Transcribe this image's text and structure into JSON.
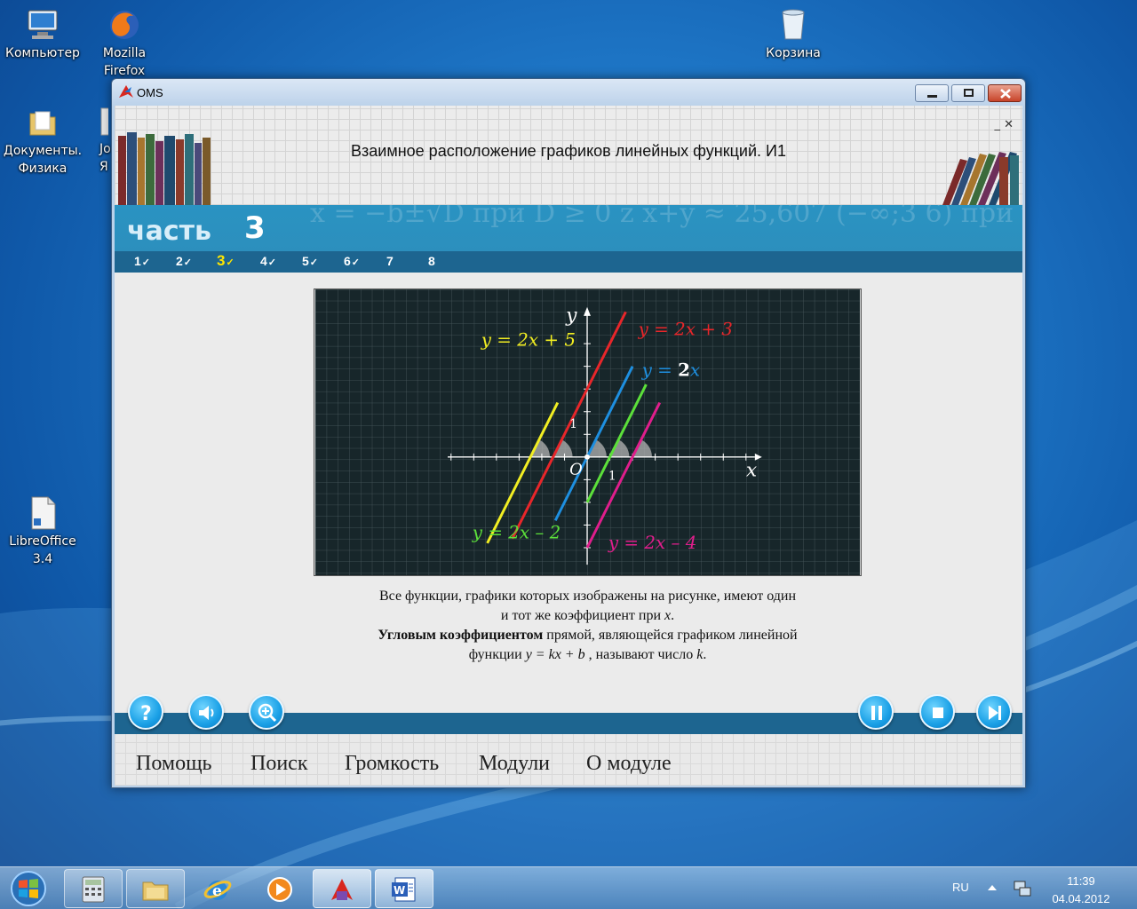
{
  "desktop": {
    "icons": [
      {
        "label": "Компьютер",
        "icon": "computer-icon"
      },
      {
        "label": "Mozilla Firefox",
        "icon": "firefox-icon"
      },
      {
        "label": "Корзина",
        "icon": "recycle-bin-icon"
      },
      {
        "label": "Документы. Физика",
        "icon": "folder-icon"
      },
      {
        "label": "Jo Я",
        "icon": "shortcut-icon"
      },
      {
        "label": "LibreOffice 3.4",
        "icon": "libreoffice-icon"
      }
    ]
  },
  "window": {
    "title": "OMS",
    "lesson_title": "Взаимное расположение графиков линейных функций. И1",
    "mini_controls": "_ ✕",
    "part": {
      "word": "часть",
      "number": "3"
    },
    "band_decor": "x = −b±√D  при D ≥ 0   z   x+y ≈ 25,607  (−∞;3 6)   при   y = √x",
    "nav": [
      {
        "num": "1",
        "check": "✓"
      },
      {
        "num": "2",
        "check": "✓"
      },
      {
        "num": "3",
        "check": "✓",
        "current": true
      },
      {
        "num": "4",
        "check": "✓"
      },
      {
        "num": "5",
        "check": "✓"
      },
      {
        "num": "6",
        "check": "✓"
      },
      {
        "num": "7",
        "check": ""
      },
      {
        "num": "8",
        "check": ""
      }
    ],
    "graph": {
      "axis_x": "x",
      "axis_y": "y",
      "origin": "O",
      "unit_x": "1",
      "unit_y": "1",
      "lines": [
        {
          "label": "y = 2x + 5",
          "k": 2,
          "b": 5,
          "color": "#f2ee22"
        },
        {
          "label": "y = 2x + 3",
          "k": 2,
          "b": 3,
          "color": "#e8262a"
        },
        {
          "label_prefix": "y = ",
          "label_bold": "2",
          "label_suffix": "x",
          "k": 2,
          "b": 0,
          "color": "#1e8fe0"
        },
        {
          "label": "y = 2x – 2",
          "k": 2,
          "b": -2,
          "color": "#5ce03a"
        },
        {
          "label": "y = 2x – 4",
          "k": 2,
          "b": -4,
          "color": "#e01e8c"
        }
      ]
    },
    "caption": {
      "line1": "Все функции, графики которых изображены на рисунке, имеют один",
      "line2a": "и тот же коэффициент при ",
      "line2var": "x",
      "line2b": ".",
      "line3bold": "Угловым коэффициентом",
      "line3rest": " прямой, являющейся графиком линейной",
      "line4a": "функции ",
      "line4formula": "y = kx + b",
      "line4b": " , называют число ",
      "line4var": "k",
      "line4c": "."
    },
    "controls": {
      "help": "question-icon",
      "volume": "speaker-icon",
      "zoom": "zoom-in-icon",
      "pause": "pause-icon",
      "stop": "stop-icon",
      "next": "next-icon"
    },
    "menu": [
      "Помощь",
      "Поиск",
      "Громкость",
      "Модули",
      "О модуле"
    ]
  },
  "taskbar": {
    "apps": [
      "calculator-icon",
      "explorer-icon",
      "ie-icon",
      "media-player-icon",
      "oms-icon",
      "word-icon"
    ],
    "lang": "RU",
    "time": "11:39",
    "date": "04.04.2012"
  }
}
